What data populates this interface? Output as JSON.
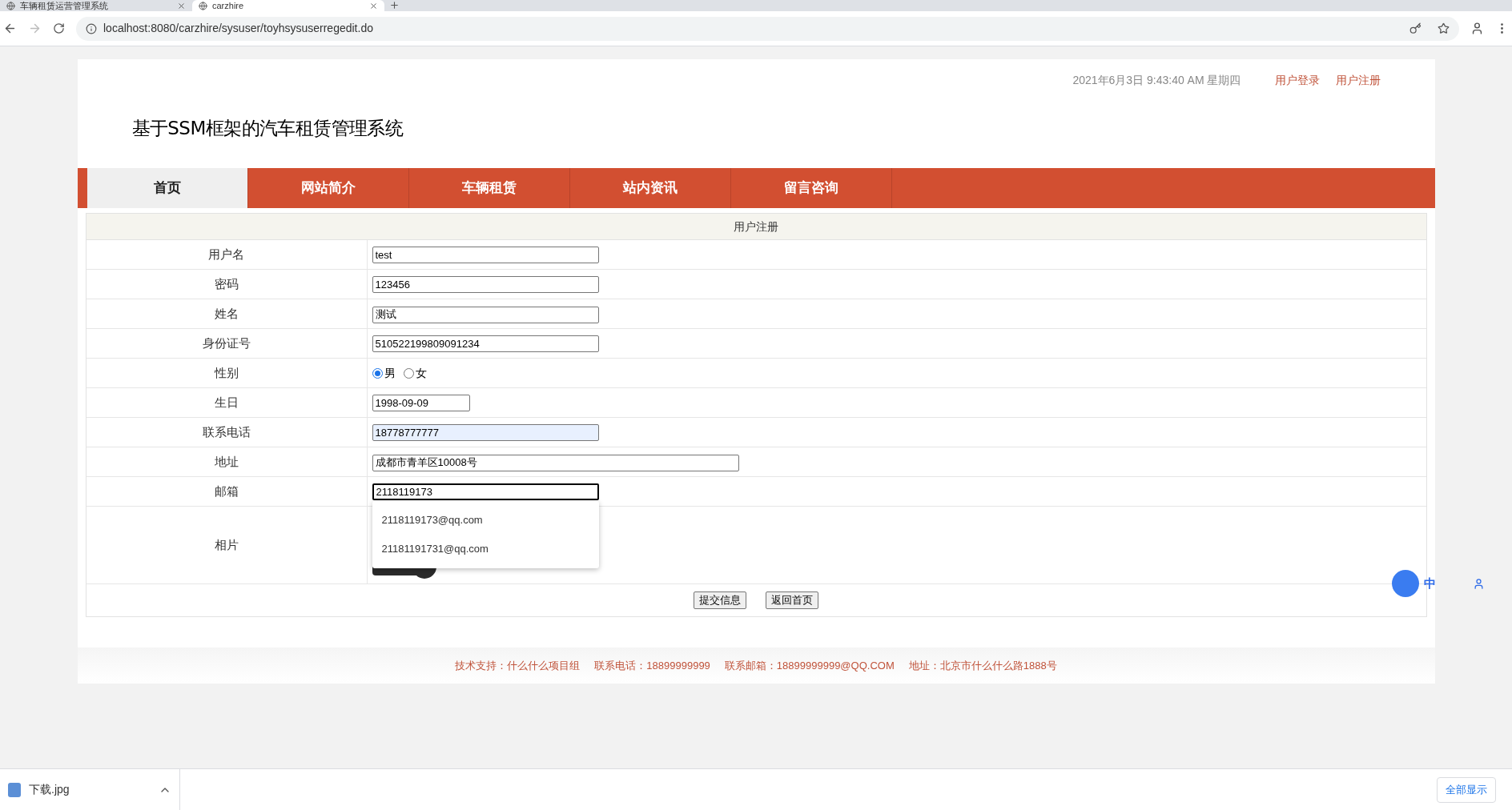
{
  "browser": {
    "tabs": [
      {
        "title": "车辆租赁运营管理系统",
        "selected": false
      },
      {
        "title": "carzhire",
        "selected": true
      }
    ],
    "url": "localhost:8080/carzhire/sysuser/toyhsysuserregedit.do"
  },
  "header": {
    "datetime": "2021年6月3日 9:43:40 AM 星期四",
    "links": [
      "用户登录",
      "用户注册"
    ],
    "site_title": "基于SSM框架的汽车租赁管理系统"
  },
  "nav": [
    {
      "label": "首页",
      "selected": true
    },
    {
      "label": "网站简介",
      "selected": false
    },
    {
      "label": "车辆租赁",
      "selected": false
    },
    {
      "label": "站内资讯",
      "selected": false
    },
    {
      "label": "留言咨询",
      "selected": false
    }
  ],
  "form": {
    "title": "用户注册",
    "fields": [
      {
        "label": "用户名",
        "kind": "text",
        "value": "test"
      },
      {
        "label": "密码",
        "kind": "text",
        "value": "123456"
      },
      {
        "label": "姓名",
        "kind": "text",
        "value": "测试"
      },
      {
        "label": "身份证号",
        "kind": "text",
        "value": "510522199809091234"
      },
      {
        "label": "性别",
        "kind": "radio",
        "options": [
          {
            "label": "男",
            "selected": true
          },
          {
            "label": "女",
            "selected": false
          }
        ]
      },
      {
        "label": "生日",
        "kind": "date",
        "value": "1998-09-09"
      },
      {
        "label": "联系电话",
        "kind": "text",
        "value": "18778777777",
        "autofilled": true
      },
      {
        "label": "地址",
        "kind": "wide",
        "value": "成都市青羊区10008号"
      },
      {
        "label": "邮箱",
        "kind": "text",
        "value": "2118119173",
        "focused": true,
        "suggestions": [
          "2118119173@qq.com",
          "21181191731@qq.com"
        ]
      },
      {
        "label": "相片",
        "kind": "photo"
      }
    ],
    "buttons": [
      "提交信息",
      "返回首页"
    ]
  },
  "footer": [
    "技术支持：什么什么项目组",
    "联系电话：18899999999",
    "联系邮箱：18899999999@QQ.COM",
    "地址：北京市什么什么路1888号"
  ],
  "ime": {
    "label": "中"
  },
  "download_bar": {
    "file": "下载.jpg",
    "show_all": "全部显示"
  }
}
